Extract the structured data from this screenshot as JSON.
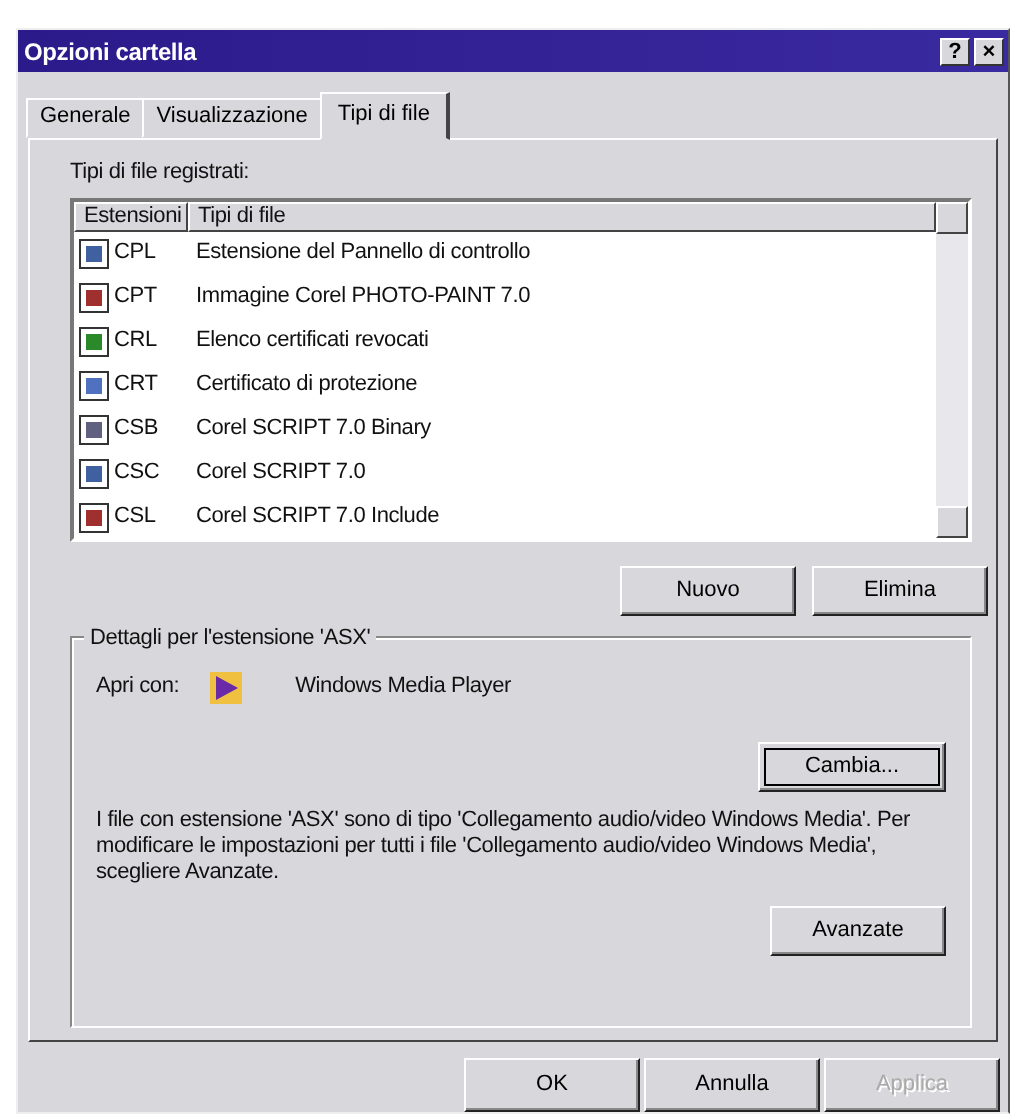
{
  "window": {
    "title": "Opzioni cartella",
    "help_button": "?",
    "close_button": "×"
  },
  "tabs": [
    {
      "label": "Generale",
      "selected": false
    },
    {
      "label": "Visualizzazione",
      "selected": false
    },
    {
      "label": "Tipi di file",
      "selected": true
    }
  ],
  "file_types": {
    "label": "Tipi di file registrati:",
    "columns": [
      "Estensioni",
      "Tipi di file"
    ],
    "rows": [
      {
        "extension": "CPL",
        "type": "Estensione del Pannello di controllo"
      },
      {
        "extension": "CPT",
        "type": "Immagine Corel PHOTO-PAINT 7.0"
      },
      {
        "extension": "CRL",
        "type": "Elenco certificati revocati"
      },
      {
        "extension": "CRT",
        "type": "Certificato di protezione"
      },
      {
        "extension": "CSB",
        "type": "Corel SCRIPT 7.0 Binary"
      },
      {
        "extension": "CSC",
        "type": "Corel SCRIPT 7.0"
      },
      {
        "extension": "CSL",
        "type": "Corel SCRIPT 7.0 Include"
      }
    ],
    "buttons": [
      "Nuovo",
      "Elimina"
    ]
  },
  "details": {
    "title": "Dettagli per l'estensione 'ASX'",
    "open_with_label": "Apri con:",
    "open_with_app": "Windows Media Player",
    "change_button": "Cambia...",
    "description": "I file con estensione 'ASX' sono di tipo 'Collegamento audio/video Windows Media'. Per modificare le impostazioni per tutti i file 'Collegamento audio/video Windows Media', scegliere Avanzate.",
    "advanced_button": "Avanzate"
  },
  "footer_buttons": [
    {
      "label": "OK",
      "disabled": false
    },
    {
      "label": "Annulla",
      "disabled": false
    },
    {
      "label": "Applica",
      "disabled": true
    }
  ]
}
